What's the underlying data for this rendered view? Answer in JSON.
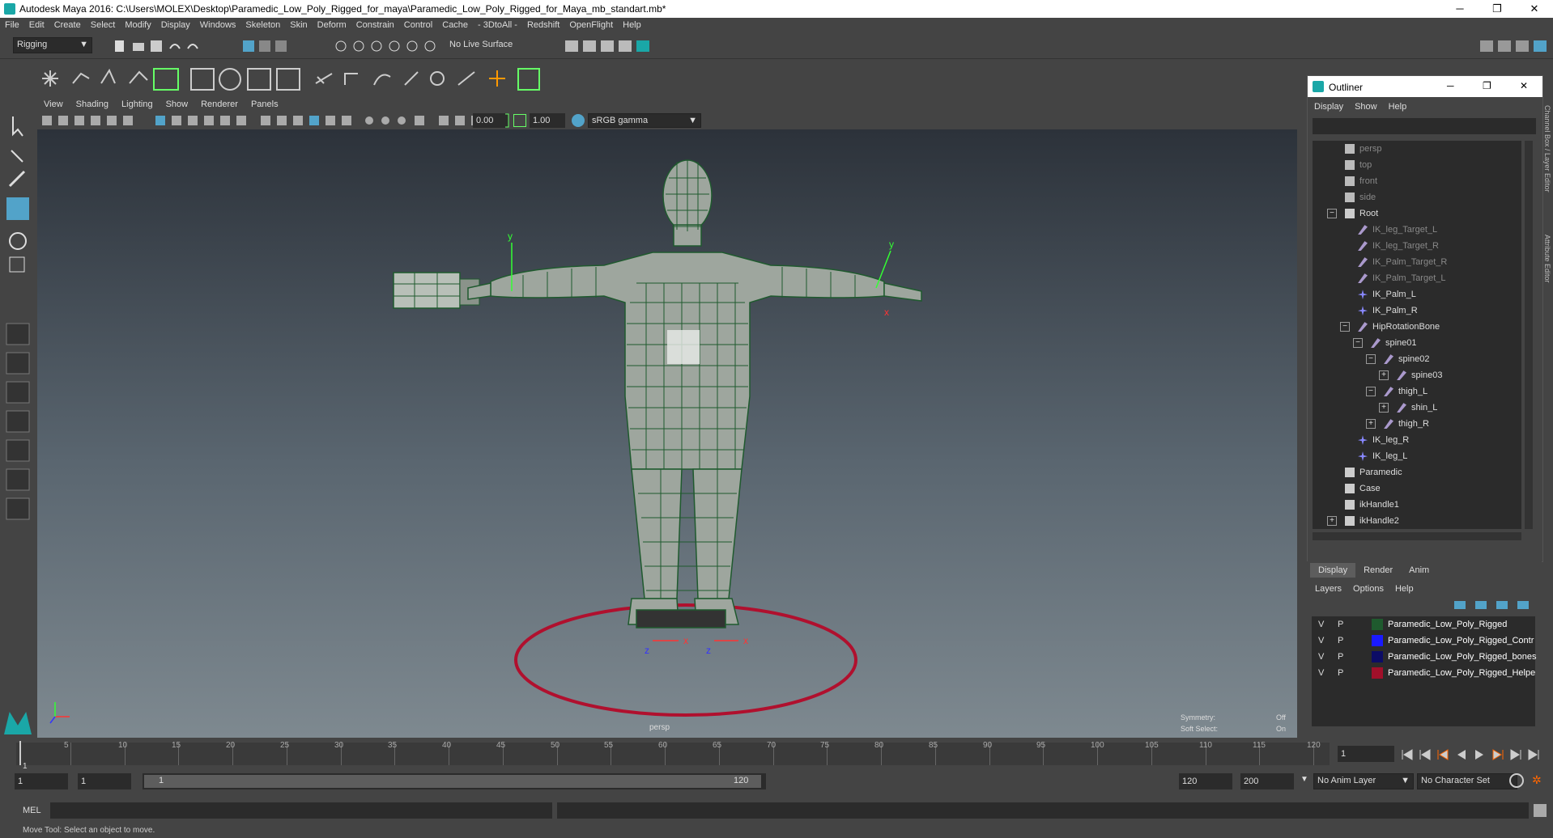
{
  "window": {
    "title": "Autodesk Maya 2016: C:\\Users\\MOLEX\\Desktop\\Paramedic_Low_Poly_Rigged_for_maya\\Paramedic_Low_Poly_Rigged_for_Maya_mb_standart.mb*",
    "minimize": "─",
    "restore": "❐",
    "close": "✕"
  },
  "menu": [
    "File",
    "Edit",
    "Create",
    "Select",
    "Modify",
    "Display",
    "Windows",
    "Skeleton",
    "Skin",
    "Deform",
    "Constrain",
    "Control",
    "Cache",
    "- 3DtoAll -",
    "Redshift",
    "OpenFlight",
    "Help"
  ],
  "status_line": {
    "mode": "Rigging",
    "live_surface": "No Live Surface"
  },
  "panel": {
    "menu": [
      "View",
      "Shading",
      "Lighting",
      "Show",
      "Renderer",
      "Panels"
    ],
    "exposure": "0.00",
    "gamma": "1.00",
    "color_space": "sRGB gamma",
    "camera_label": "persp",
    "hud": {
      "symmetry_label": "Symmetry:",
      "symmetry_value": "Off",
      "soft_select_label": "Soft Select:",
      "soft_select_value": "On"
    },
    "axis": {
      "x": "x",
      "y": "y",
      "z": "z"
    }
  },
  "outliner": {
    "title": "Outliner",
    "menu": [
      "Display",
      "Show",
      "Help"
    ],
    "items": [
      {
        "label": "persp",
        "indent": 0,
        "dim": true,
        "icon": "camera-icon"
      },
      {
        "label": "top",
        "indent": 0,
        "dim": true,
        "icon": "camera-icon"
      },
      {
        "label": "front",
        "indent": 0,
        "dim": true,
        "icon": "camera-icon"
      },
      {
        "label": "side",
        "indent": 0,
        "dim": true,
        "icon": "camera-icon"
      },
      {
        "label": "Root",
        "indent": 0,
        "dim": false,
        "icon": "group-icon",
        "expander": "−"
      },
      {
        "label": "IK_leg_Target_L",
        "indent": 1,
        "dim": true,
        "icon": "joint-icon"
      },
      {
        "label": "IK_leg_Target_R",
        "indent": 1,
        "dim": true,
        "icon": "joint-icon"
      },
      {
        "label": "IK_Palm_Target_R",
        "indent": 1,
        "dim": true,
        "icon": "joint-icon"
      },
      {
        "label": "IK_Palm_Target_L",
        "indent": 1,
        "dim": true,
        "icon": "joint-icon"
      },
      {
        "label": "IK_Palm_L",
        "indent": 1,
        "dim": false,
        "icon": "ik-icon"
      },
      {
        "label": "IK_Palm_R",
        "indent": 1,
        "dim": false,
        "icon": "ik-icon"
      },
      {
        "label": "HipRotationBone",
        "indent": 1,
        "dim": false,
        "icon": "joint-icon",
        "expander": "−"
      },
      {
        "label": "spine01",
        "indent": 2,
        "dim": false,
        "icon": "joint-icon",
        "expander": "−"
      },
      {
        "label": "spine02",
        "indent": 3,
        "dim": false,
        "icon": "joint-icon",
        "expander": "−"
      },
      {
        "label": "spine03",
        "indent": 4,
        "dim": false,
        "icon": "joint-icon",
        "expander": "+"
      },
      {
        "label": "thigh_L",
        "indent": 3,
        "dim": false,
        "icon": "joint-icon",
        "expander": "−"
      },
      {
        "label": "shin_L",
        "indent": 4,
        "dim": false,
        "icon": "joint-icon",
        "expander": "+"
      },
      {
        "label": "thigh_R",
        "indent": 3,
        "dim": false,
        "icon": "joint-icon",
        "expander": "+"
      },
      {
        "label": "IK_leg_R",
        "indent": 1,
        "dim": false,
        "icon": "ik-icon"
      },
      {
        "label": "IK_leg_L",
        "indent": 1,
        "dim": false,
        "icon": "ik-icon"
      },
      {
        "label": "Paramedic",
        "indent": 0,
        "dim": false,
        "icon": "group-icon"
      },
      {
        "label": "Case",
        "indent": 0,
        "dim": false,
        "icon": "group-icon"
      },
      {
        "label": "ikHandle1",
        "indent": 0,
        "dim": false,
        "icon": "ikhandle-icon"
      },
      {
        "label": "ikHandle2",
        "indent": 0,
        "dim": false,
        "icon": "ikhandle-icon",
        "expander": "+"
      }
    ]
  },
  "layer_editor": {
    "tabs": [
      "Display",
      "Render",
      "Anim"
    ],
    "menu": [
      "Layers",
      "Options",
      "Help"
    ],
    "layers": [
      {
        "v": "V",
        "p": "P",
        "name": "Paramedic_Low_Poly_Rigged",
        "color": "#1f5a2e"
      },
      {
        "v": "V",
        "p": "P",
        "name": "Paramedic_Low_Poly_Rigged_Contr",
        "color": "#1a1aff"
      },
      {
        "v": "V",
        "p": "P",
        "name": "Paramedic_Low_Poly_Rigged_bones",
        "color": "#0c0c66"
      },
      {
        "v": "V",
        "p": "P",
        "name": "Paramedic_Low_Poly_Rigged_Helpe",
        "color": "#a0102a"
      }
    ]
  },
  "side_tabs": {
    "channel_box": "Channel Box / Layer Editor",
    "attribute_editor": "Attribute Editor"
  },
  "timeline": {
    "ticks": [
      "5",
      "10",
      "15",
      "20",
      "25",
      "30",
      "35",
      "40",
      "45",
      "50",
      "55",
      "60",
      "65",
      "70",
      "75",
      "80",
      "85",
      "90",
      "95",
      "100",
      "105",
      "110",
      "115",
      "120"
    ],
    "start_label": "1",
    "current_frame": "1"
  },
  "range": {
    "start": "1",
    "playback_start": "1",
    "slider_start": "1",
    "slider_end": "120",
    "playback_end": "120",
    "end": "200",
    "anim_layer": "No Anim Layer",
    "char_set": "No Character Set"
  },
  "command": {
    "label": "MEL"
  },
  "help_line": "Move Tool: Select an object to move.",
  "colors": {
    "accent": "#52a3c9",
    "control_circle": "#b0102e",
    "wire": "#1f5a2e"
  }
}
